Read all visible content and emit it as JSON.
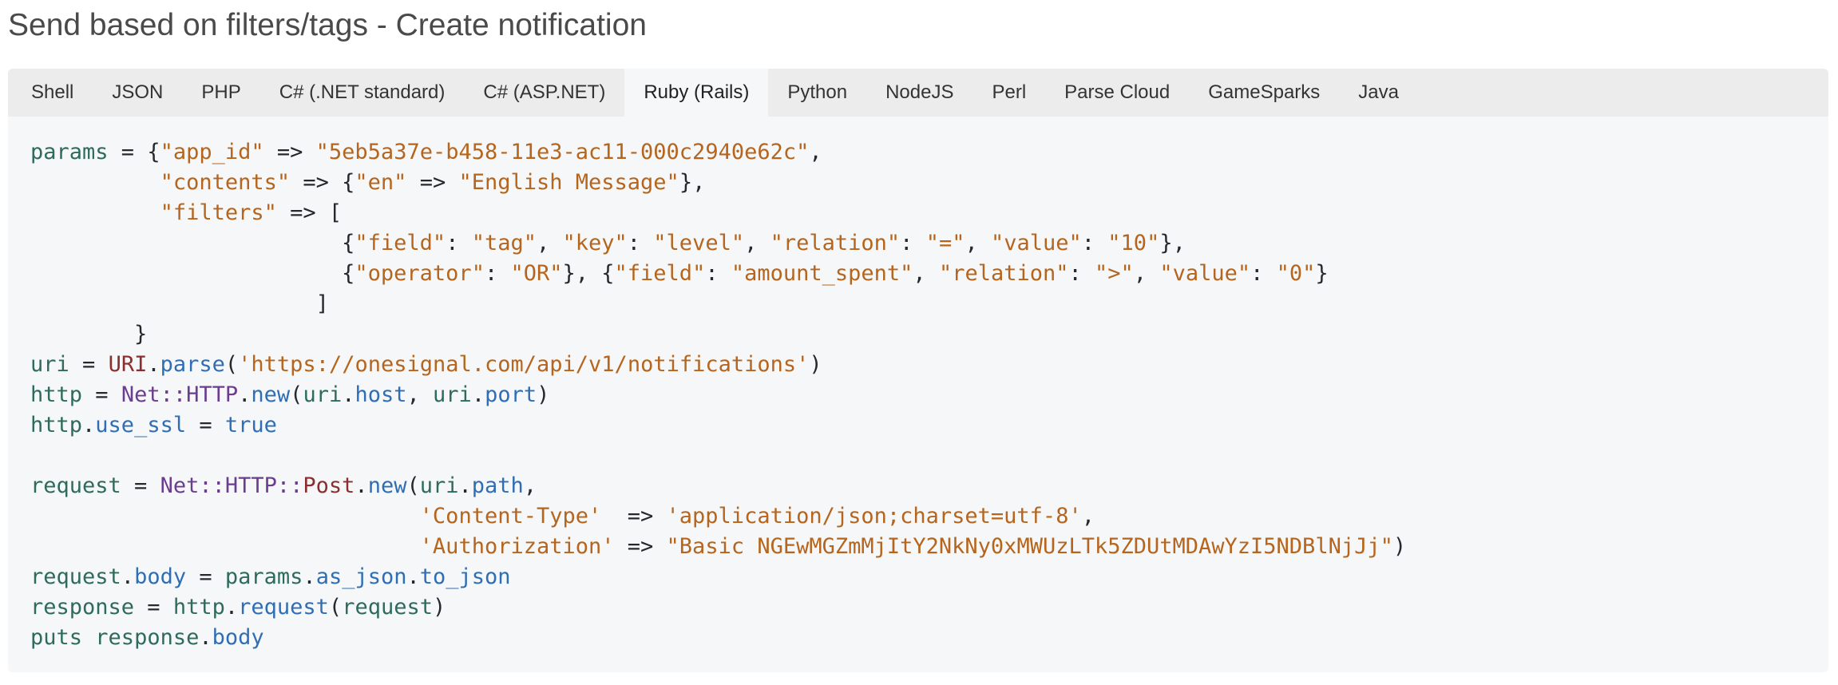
{
  "page": {
    "title": "Send based on filters/tags - Create notification"
  },
  "tabs": [
    {
      "label": "Shell",
      "active": false
    },
    {
      "label": "JSON",
      "active": false
    },
    {
      "label": "PHP",
      "active": false
    },
    {
      "label": "C# (.NET standard)",
      "active": false
    },
    {
      "label": "C# (ASP.NET)",
      "active": false
    },
    {
      "label": "Ruby (Rails)",
      "active": true
    },
    {
      "label": "Python",
      "active": false
    },
    {
      "label": "NodeJS",
      "active": false
    },
    {
      "label": "Perl",
      "active": false
    },
    {
      "label": "Parse Cloud",
      "active": false
    },
    {
      "label": "GameSparks",
      "active": false
    },
    {
      "label": "Java",
      "active": false
    }
  ],
  "code": {
    "language": "ruby",
    "colors": {
      "variable": "#2e6b5a",
      "string": "#b5651d",
      "class": "#8b2e2e",
      "namespace": "#6a3d8f",
      "method": "#2f6eb5",
      "punctuation": "#24292e",
      "background": "#f6f7f8",
      "tab_bar": "#ececec"
    },
    "lines": [
      [
        [
          "var",
          "params"
        ],
        [
          "p",
          " = {"
        ],
        [
          "str",
          "\"app_id\""
        ],
        [
          "p",
          " => "
        ],
        [
          "str",
          "\"5eb5a37e-b458-11e3-ac11-000c2940e62c\""
        ],
        [
          "p",
          ","
        ]
      ],
      [
        [
          "p",
          "          "
        ],
        [
          "str",
          "\"contents\""
        ],
        [
          "p",
          " => {"
        ],
        [
          "str",
          "\"en\""
        ],
        [
          "p",
          " => "
        ],
        [
          "str",
          "\"English Message\""
        ],
        [
          "p",
          "},"
        ]
      ],
      [
        [
          "p",
          "          "
        ],
        [
          "str",
          "\"filters\""
        ],
        [
          "p",
          " => ["
        ]
      ],
      [
        [
          "p",
          "                        {"
        ],
        [
          "str",
          "\"field\""
        ],
        [
          "p",
          ": "
        ],
        [
          "str",
          "\"tag\""
        ],
        [
          "p",
          ", "
        ],
        [
          "str",
          "\"key\""
        ],
        [
          "p",
          ": "
        ],
        [
          "str",
          "\"level\""
        ],
        [
          "p",
          ", "
        ],
        [
          "str",
          "\"relation\""
        ],
        [
          "p",
          ": "
        ],
        [
          "str",
          "\"=\""
        ],
        [
          "p",
          ", "
        ],
        [
          "str",
          "\"value\""
        ],
        [
          "p",
          ": "
        ],
        [
          "str",
          "\"10\""
        ],
        [
          "p",
          "},"
        ]
      ],
      [
        [
          "p",
          "                        {"
        ],
        [
          "str",
          "\"operator\""
        ],
        [
          "p",
          ": "
        ],
        [
          "str",
          "\"OR\""
        ],
        [
          "p",
          "}, {"
        ],
        [
          "str",
          "\"field\""
        ],
        [
          "p",
          ": "
        ],
        [
          "str",
          "\"amount_spent\""
        ],
        [
          "p",
          ", "
        ],
        [
          "str",
          "\"relation\""
        ],
        [
          "p",
          ": "
        ],
        [
          "str",
          "\">\""
        ],
        [
          "p",
          ", "
        ],
        [
          "str",
          "\"value\""
        ],
        [
          "p",
          ": "
        ],
        [
          "str",
          "\"0\""
        ],
        [
          "p",
          "}"
        ]
      ],
      [
        [
          "p",
          "                      ]"
        ]
      ],
      [
        [
          "p",
          "        }"
        ]
      ],
      [
        [
          "var",
          "uri"
        ],
        [
          "p",
          " = "
        ],
        [
          "cls",
          "URI"
        ],
        [
          "p",
          "."
        ],
        [
          "meth",
          "parse"
        ],
        [
          "p",
          "("
        ],
        [
          "str",
          "'https://onesignal.com/api/v1/notifications'"
        ],
        [
          "p",
          ")"
        ]
      ],
      [
        [
          "var",
          "http"
        ],
        [
          "p",
          " = "
        ],
        [
          "ns",
          "Net::HTTP"
        ],
        [
          "p",
          "."
        ],
        [
          "meth",
          "new"
        ],
        [
          "p",
          "("
        ],
        [
          "var",
          "uri"
        ],
        [
          "p",
          "."
        ],
        [
          "meth",
          "host"
        ],
        [
          "p",
          ", "
        ],
        [
          "var",
          "uri"
        ],
        [
          "p",
          "."
        ],
        [
          "meth",
          "port"
        ],
        [
          "p",
          ")"
        ]
      ],
      [
        [
          "var",
          "http"
        ],
        [
          "p",
          "."
        ],
        [
          "meth",
          "use_ssl"
        ],
        [
          "p",
          " = "
        ],
        [
          "kw",
          "true"
        ]
      ],
      [
        [
          "p",
          ""
        ]
      ],
      [
        [
          "var",
          "request"
        ],
        [
          "p",
          " = "
        ],
        [
          "ns",
          "Net::HTTP::"
        ],
        [
          "cls",
          "Post"
        ],
        [
          "p",
          "."
        ],
        [
          "meth",
          "new"
        ],
        [
          "p",
          "("
        ],
        [
          "var",
          "uri"
        ],
        [
          "p",
          "."
        ],
        [
          "meth",
          "path"
        ],
        [
          "p",
          ","
        ]
      ],
      [
        [
          "p",
          "                              "
        ],
        [
          "str",
          "'Content-Type'"
        ],
        [
          "p",
          "  => "
        ],
        [
          "str",
          "'application/json;charset=utf-8'"
        ],
        [
          "p",
          ","
        ]
      ],
      [
        [
          "p",
          "                              "
        ],
        [
          "str",
          "'Authorization'"
        ],
        [
          "p",
          " => "
        ],
        [
          "str",
          "\"Basic NGEwMGZmMjItY2NkNy0xMWUzLTk5ZDUtMDAwYzI5NDBlNjJj\""
        ],
        [
          "p",
          ")"
        ]
      ],
      [
        [
          "var",
          "request"
        ],
        [
          "p",
          "."
        ],
        [
          "meth",
          "body"
        ],
        [
          "p",
          " = "
        ],
        [
          "var",
          "params"
        ],
        [
          "p",
          "."
        ],
        [
          "meth",
          "as_json"
        ],
        [
          "p",
          "."
        ],
        [
          "meth",
          "to_json"
        ]
      ],
      [
        [
          "var",
          "response"
        ],
        [
          "p",
          " = "
        ],
        [
          "var",
          "http"
        ],
        [
          "p",
          "."
        ],
        [
          "meth",
          "request"
        ],
        [
          "p",
          "("
        ],
        [
          "var",
          "request"
        ],
        [
          "p",
          ")"
        ]
      ],
      [
        [
          "var",
          "puts"
        ],
        [
          "p",
          " "
        ],
        [
          "var",
          "response"
        ],
        [
          "p",
          "."
        ],
        [
          "meth",
          "body"
        ]
      ]
    ]
  }
}
